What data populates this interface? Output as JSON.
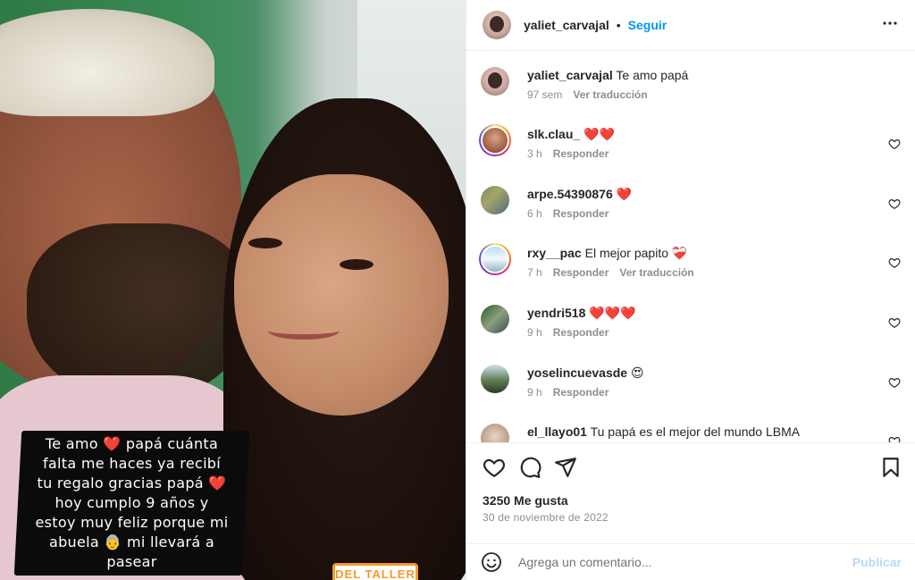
{
  "post": {
    "username": "yaliet_carvajal",
    "dot": "•",
    "follow_label": "Seguir",
    "more_label": "•••",
    "caption": {
      "username": "yaliet_carvajal",
      "text": "Te amo papá",
      "time": "97 sem",
      "translate": "Ver traducción"
    }
  },
  "story": {
    "lines": [
      "Te amo ❤️ papá cuánta",
      "falta me haces ya recibí",
      "tu regalo gracias papá ❤️",
      "hoy cumplo 9 años y",
      "estoy muy feliz porque mi",
      "abuela 👵 mi llevará a",
      "pasear"
    ],
    "sticker": "DEL TALLER"
  },
  "comments": [
    {
      "username": "slk.clau_",
      "text": "❤️❤️",
      "time": "3 h",
      "reply": "Responder",
      "translate": ""
    },
    {
      "username": "arpe.54390876",
      "text": "❤️",
      "time": "6 h",
      "reply": "Responder",
      "translate": ""
    },
    {
      "username": "rxy__pac",
      "text": "El mejor papito ❤️‍🩹",
      "time": "7 h",
      "reply": "Responder",
      "translate": "Ver traducción"
    },
    {
      "username": "yendri518",
      "text": "❤️❤️❤️",
      "time": "9 h",
      "reply": "Responder",
      "translate": ""
    },
    {
      "username": "yoselincuevasde",
      "text": "😍",
      "time": "9 h",
      "reply": "Responder",
      "translate": ""
    },
    {
      "username": "el_llayo01",
      "text": "Tu papá es el mejor del mundo LBMA",
      "time": "",
      "reply": "",
      "translate": ""
    }
  ],
  "stats": {
    "likes": "3250 Me gusta",
    "date": "30 de noviembre de 2022"
  },
  "composer": {
    "placeholder": "Agrega un comentario...",
    "publish_label": "Publicar"
  },
  "colors": {
    "accent": "#0095f6",
    "publish_disabled": "#b3dbff",
    "muted": "#8e8e8e",
    "sticker": "#f39a2a"
  },
  "icons": {
    "like": "heart-icon",
    "comment": "comment-icon",
    "share": "share-icon",
    "save": "bookmark-icon",
    "emoji": "emoji-icon",
    "more": "more-icon"
  }
}
